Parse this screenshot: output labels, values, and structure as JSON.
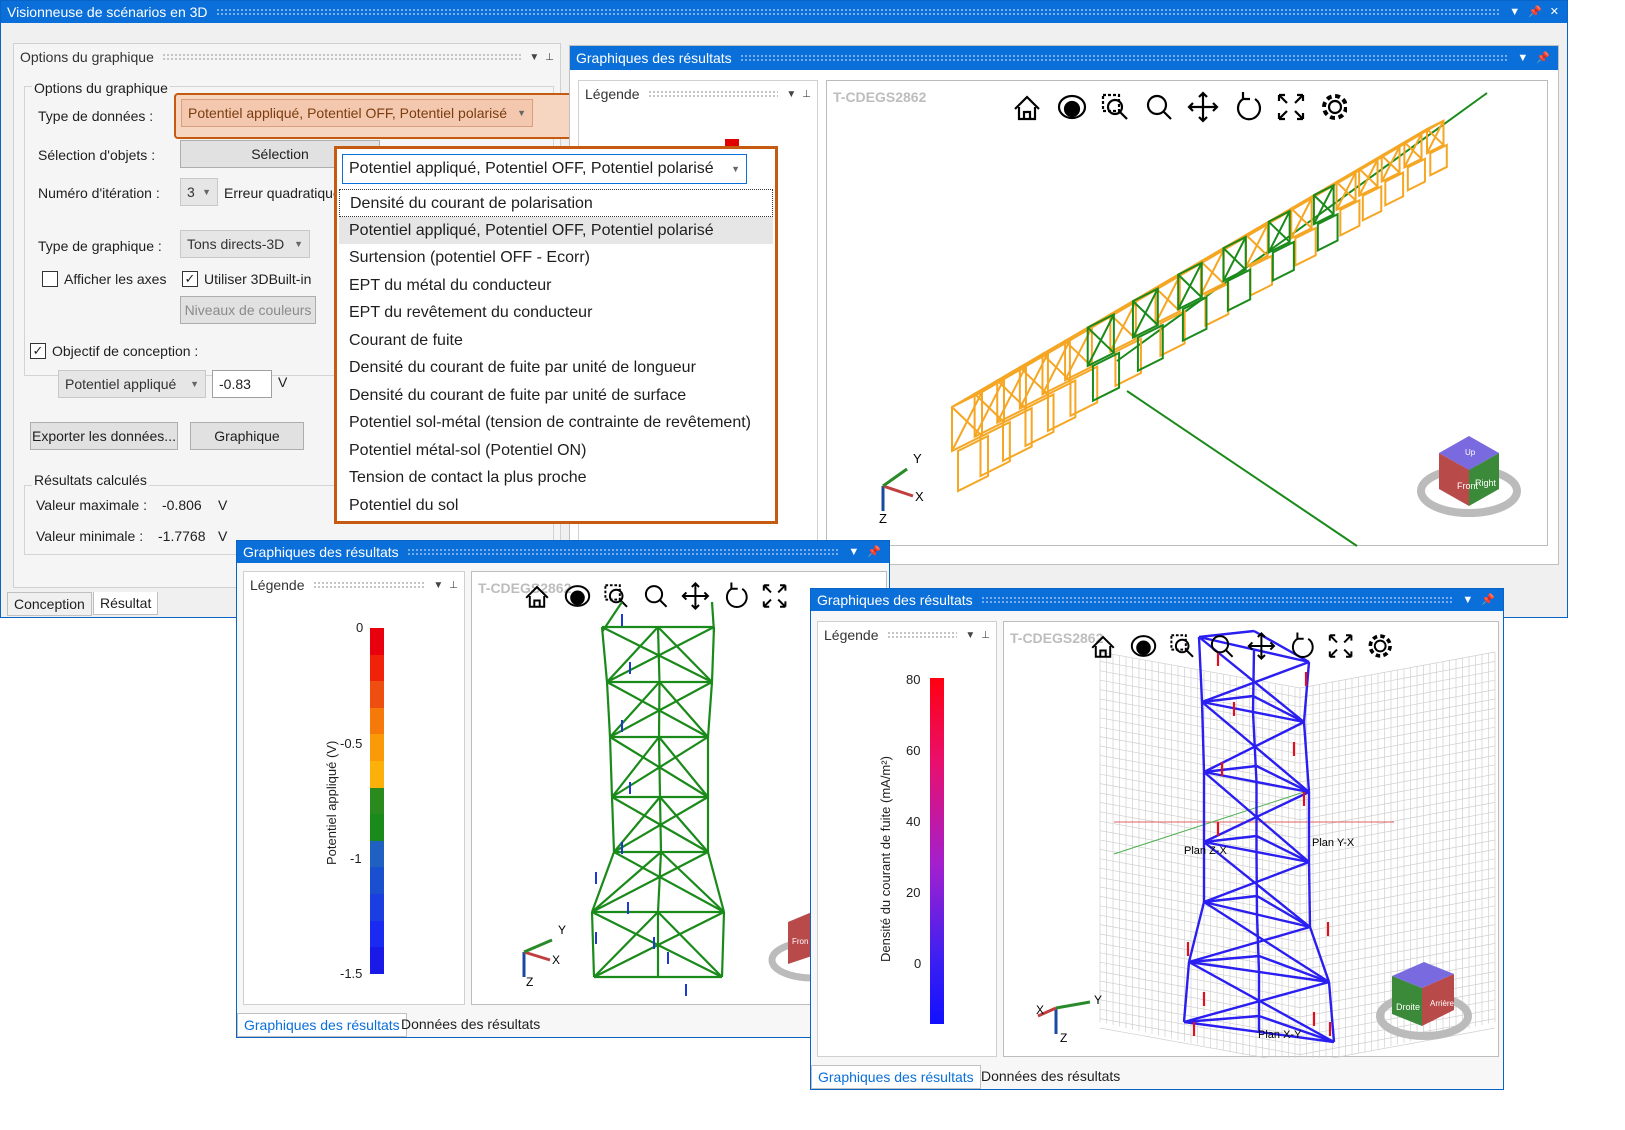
{
  "main": {
    "title": "Visionneuse de scénarios en 3D"
  },
  "options": {
    "panel_title": "Options du graphique",
    "group_title": "Options du graphique",
    "data_type_label": "Type de données :",
    "data_type_value": "Potentiel appliqué, Potentiel OFF, Potentiel polarisé",
    "object_sel_label": "Sélection d'objets :",
    "object_sel_button": "Sélection",
    "iteration_label": "Numéro d'itération :",
    "iteration_value": "3",
    "error_label": "Erreur quadratique",
    "graph_type_label": "Type de graphique :",
    "graph_type_value": "Tons directs-3D",
    "show_axes_label": "Afficher les axes",
    "use3d_label": "Utiliser 3DBuilt-in",
    "color_levels_button": "Niveaux de couleurs",
    "design_goal_label": "Objectif de conception :",
    "design_goal_type": "Potentiel appliqué",
    "design_goal_value": "-0.83",
    "design_goal_unit": "V",
    "export_button": "Exporter les données...",
    "graph_button": "Graphique",
    "results_title": "Résultats calculés",
    "max_label": "Valeur maximale :",
    "max_value": "-0.806",
    "min_label": "Valeur minimale :",
    "min_value": "-1.7768",
    "unit": "V"
  },
  "tabs": {
    "design": "Conception",
    "result": "Résultat"
  },
  "dropdown": {
    "selected": "Potentiel appliqué, Potentiel OFF, Potentiel polarisé",
    "items": [
      "Densité du courant de polarisation",
      "Potentiel appliqué, Potentiel OFF, Potentiel polarisé",
      "Surtension (potentiel OFF - Ecorr)",
      "EPT du métal du conducteur",
      "EPT du revêtement du conducteur",
      "Courant de fuite",
      "Densité du courant de fuite par unité de longueur",
      "Densité du courant de fuite par unité de surface",
      "Potentiel sol-métal (tension de contrainte de revêtement)",
      "Potentiel métal-sol (Potentiel ON)",
      "Tension de contact la plus proche",
      "Potentiel du sol"
    ]
  },
  "results_main": {
    "title": "Graphiques des résultats",
    "legend": "Légende",
    "watermark": "T-CDEGS2862"
  },
  "axes": {
    "x": "X",
    "y": "Y",
    "z": "Z"
  },
  "cube": {
    "top": "Up",
    "front": "Front",
    "right": "Right",
    "droite": "Droite",
    "arriere": "Arrière",
    "front2": "Fron"
  },
  "win2": {
    "title": "Graphiques des résultats",
    "legend": "Légende",
    "watermark": "T-CDEGS2862",
    "tab1": "Graphiques des résultats",
    "tab2": "Données des résultats",
    "scale_label": "Potentiel appliqué (V)",
    "ticks": [
      "0",
      "-0.5",
      "-1",
      "-1.5"
    ],
    "colors": [
      "#e8000f",
      "#f0220a",
      "#ee4f10",
      "#f57a0a",
      "#fa9a08",
      "#fbb00a",
      "#2a8a1e",
      "#1a8a1a",
      "#2060c0",
      "#1a50d0",
      "#1a3ee0",
      "#1a2af0",
      "#1a1ae8"
    ]
  },
  "win3": {
    "title": "Graphiques des résultats",
    "legend": "Légende",
    "watermark": "T-CDEGS2862",
    "tab1": "Graphiques des résultats",
    "tab2": "Données des résultats",
    "scale_label": "Densité du courant de fuite (mA/m²)",
    "ticks": [
      "80",
      "60",
      "40",
      "20",
      "0"
    ],
    "plane_zx": "Plan Z-X",
    "plane_yx": "Plan Y-X",
    "plane_xy": "Plan X-Y"
  },
  "colors": {
    "accent": "#0a6fd8",
    "highlight": "#c55a11",
    "orange_mesh": "#f5a623",
    "green_mesh": "#1a8a1a",
    "blue_mesh": "#2a1ef0"
  }
}
